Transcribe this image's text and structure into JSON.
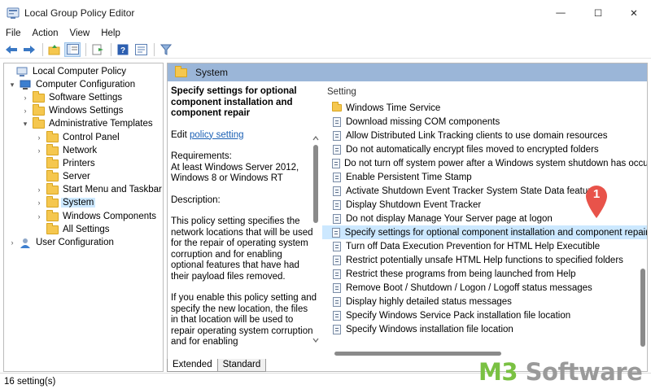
{
  "window": {
    "title": "Local Group Policy Editor",
    "minimize": "—",
    "maximize": "☐",
    "close": "✕"
  },
  "menu": [
    "File",
    "Action",
    "View",
    "Help"
  ],
  "tree": {
    "items": [
      {
        "label": "Local Computer Policy",
        "icon": "computer-policy-icon",
        "arrow": ""
      },
      {
        "label": "Computer Configuration",
        "icon": "computer-icon",
        "arrow": "▾"
      },
      {
        "label": "Software Settings",
        "icon": "folder-icon",
        "arrow": "›"
      },
      {
        "label": "Windows Settings",
        "icon": "folder-icon",
        "arrow": "›"
      },
      {
        "label": "Administrative Templates",
        "icon": "folder-icon",
        "arrow": "▾"
      },
      {
        "label": "Control Panel",
        "icon": "folder-icon",
        "arrow": "›"
      },
      {
        "label": "Network",
        "icon": "folder-icon",
        "arrow": "›"
      },
      {
        "label": "Printers",
        "icon": "folder-icon",
        "arrow": ""
      },
      {
        "label": "Server",
        "icon": "folder-icon",
        "arrow": ""
      },
      {
        "label": "Start Menu and Taskbar",
        "icon": "folder-icon",
        "arrow": "›"
      },
      {
        "label": "System",
        "icon": "folder-icon",
        "arrow": "›",
        "selected": true
      },
      {
        "label": "Windows Components",
        "icon": "folder-icon",
        "arrow": "›"
      },
      {
        "label": "All Settings",
        "icon": "folder-icon",
        "arrow": ""
      },
      {
        "label": "User Configuration",
        "icon": "user-icon",
        "arrow": "›"
      }
    ]
  },
  "rightpane": {
    "header": "System",
    "description": {
      "policy_title": "Specify settings for optional component installation and component repair",
      "edit_prefix": "Edit ",
      "edit_link": "policy setting",
      "requirements": "Requirements:\nAt least Windows Server 2012, Windows 8 or Windows RT",
      "description_label": "Description:",
      "body1": "This policy setting specifies the network locations that will be used for the repair of operating system corruption and for enabling optional features that have had their payload files removed.",
      "body2": "If you enable this policy setting and specify the new location, the files in that location will be used to repair operating system corruption and for enabling"
    },
    "list_header": "Setting",
    "settings": [
      {
        "label": "Windows Time Service",
        "type": "folder"
      },
      {
        "label": "Download missing COM components",
        "type": "policy"
      },
      {
        "label": "Allow Distributed Link Tracking clients to use domain resources",
        "type": "policy"
      },
      {
        "label": "Do not automatically encrypt files moved to encrypted folders",
        "type": "policy"
      },
      {
        "label": "Do not turn off system power after a Windows system shutdown has occurred.",
        "type": "policy"
      },
      {
        "label": "Enable Persistent Time Stamp",
        "type": "policy"
      },
      {
        "label": "Activate Shutdown Event Tracker System State Data feature",
        "type": "policy"
      },
      {
        "label": "Display Shutdown Event Tracker",
        "type": "policy"
      },
      {
        "label": "Do not display Manage Your Server page at logon",
        "type": "policy"
      },
      {
        "label": "Specify settings for optional component installation and component repair",
        "type": "policy",
        "selected": true
      },
      {
        "label": "Turn off Data Execution Prevention for HTML Help Executible",
        "type": "policy"
      },
      {
        "label": "Restrict potentially unsafe HTML Help functions to specified folders",
        "type": "policy"
      },
      {
        "label": "Restrict these programs from being launched from Help",
        "type": "policy"
      },
      {
        "label": "Remove Boot / Shutdown / Logon / Logoff status messages",
        "type": "policy"
      },
      {
        "label": "Display highly detailed status messages",
        "type": "policy"
      },
      {
        "label": "Specify Windows Service Pack installation file location",
        "type": "policy"
      },
      {
        "label": "Specify Windows installation file location",
        "type": "policy"
      }
    ],
    "tabs": [
      "Extended",
      "Standard"
    ]
  },
  "status": "16 setting(s)",
  "annotation_number": "1",
  "watermark": {
    "brand": "M3 ",
    "product": "Software"
  },
  "colors": {
    "header_bar": "#9bb6d8",
    "selection": "#cce8ff",
    "folder": "#f5c74f",
    "badge": "#e8534a",
    "watermark_green": "#7ac143"
  }
}
